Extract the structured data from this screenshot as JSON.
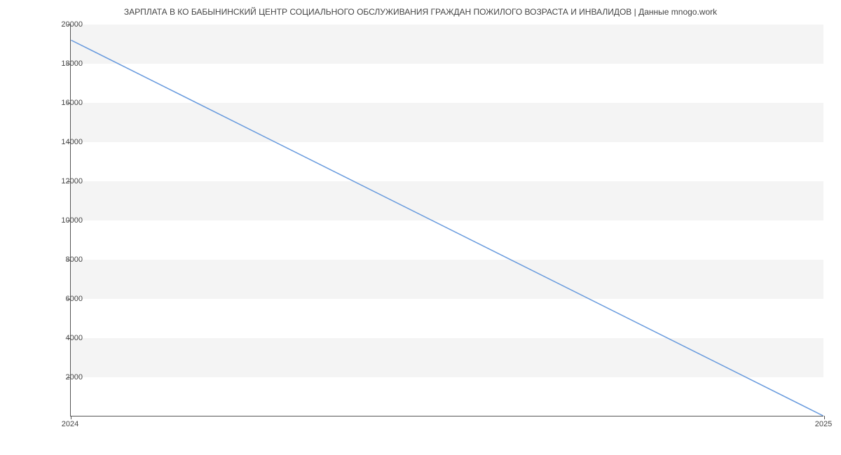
{
  "chart_data": {
    "type": "line",
    "title": "ЗАРПЛАТА В КО БАБЫНИНСКИЙ ЦЕНТР СОЦИАЛЬНОГО ОБСЛУЖИВАНИЯ ГРАЖДАН ПОЖИЛОГО ВОЗРАСТА И ИНВАЛИДОВ | Данные mnogo.work",
    "x": [
      2024,
      2025
    ],
    "values": [
      19200,
      0
    ],
    "x_ticks": [
      2024,
      2025
    ],
    "y_ticks": [
      2000,
      4000,
      6000,
      8000,
      10000,
      12000,
      14000,
      16000,
      18000,
      20000
    ],
    "xlim": [
      2024,
      2025
    ],
    "ylim": [
      0,
      20000
    ],
    "line_color": "#6699dd",
    "band_color": "#f4f4f4"
  }
}
